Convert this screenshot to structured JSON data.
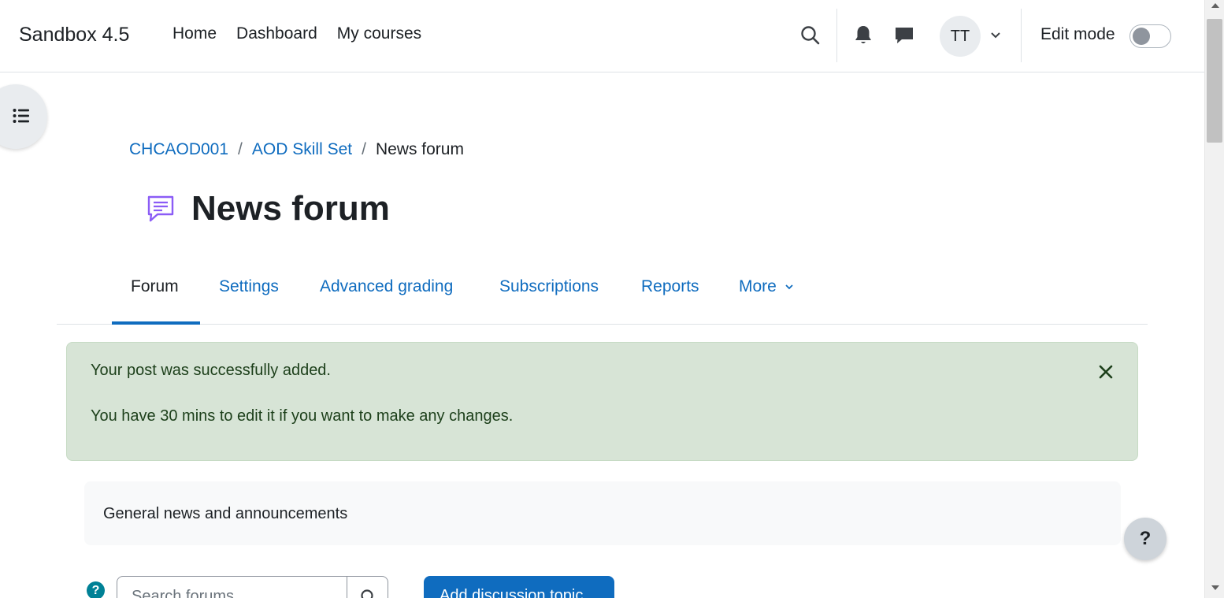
{
  "navbar": {
    "brand": "Sandbox 4.5",
    "links": [
      "Home",
      "Dashboard",
      "My courses"
    ],
    "avatar_initials": "TT",
    "edit_mode_label": "Edit mode",
    "edit_mode_on": false
  },
  "breadcrumb": {
    "items": [
      "CHCAOD001",
      "AOD Skill Set"
    ],
    "separator": "/",
    "current": "News forum"
  },
  "page": {
    "title": "News forum"
  },
  "tabs": {
    "items": [
      "Forum",
      "Settings",
      "Advanced grading",
      "Subscriptions",
      "Reports",
      "More"
    ],
    "active": "Forum"
  },
  "alert": {
    "line1": "Your post was successfully added.",
    "line2": "You have 30 mins to edit it if you want to make any changes."
  },
  "intro": {
    "text": "General news and announcements"
  },
  "controls": {
    "help_symbol": "?",
    "search_placeholder": "Search forums",
    "add_button": "Add discussion topic"
  },
  "fab": {
    "help_symbol": "?"
  },
  "colors": {
    "link": "#0f6cbf",
    "primary_button": "#0f6cbf",
    "alert_background": "#d7e4d6",
    "alert_text": "#1c3f1a",
    "forum_icon": "#8b5cf6"
  },
  "icons": [
    "search-icon",
    "bell-icon",
    "chat-icon",
    "chevron-down-icon",
    "list-icon",
    "forum-icon",
    "close-icon",
    "question-icon"
  ]
}
